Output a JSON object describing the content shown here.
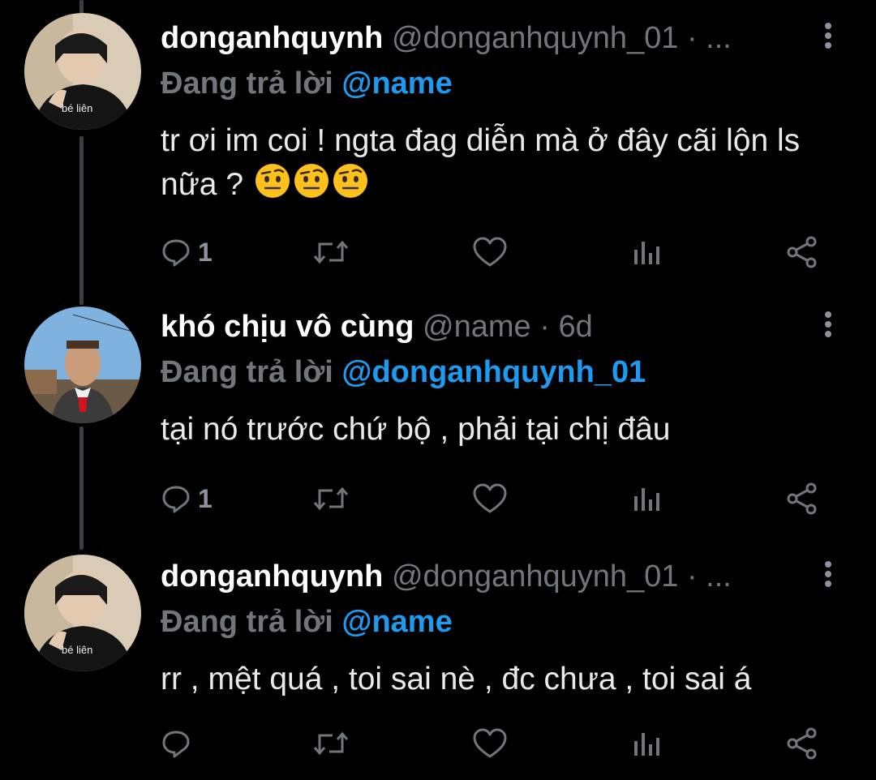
{
  "tweets": [
    {
      "display_name": "donganhquynh",
      "handle": "@donganhquynh_01",
      "meta": "· ...",
      "reply_prefix": "Đang trả lời ",
      "reply_to": "@name",
      "body": "tr ơi im coi ! ngta đag diễn mà ở đây cãi lộn ls nữa ?",
      "body_emojis": [
        "raised-eyebrow-emoji",
        "raised-eyebrow-emoji",
        "raised-eyebrow-emoji"
      ],
      "reply_count": "1",
      "avatar_text": "bé liên"
    },
    {
      "display_name": "khó chịu vô cùng",
      "handle": "@name",
      "meta": "· 6d",
      "reply_prefix": "Đang trả lời ",
      "reply_to": "@donganhquynh_01",
      "body": "tại nó trước chứ bộ , phải tại chị đâu",
      "reply_count": "1"
    },
    {
      "display_name": "donganhquynh",
      "handle": "@donganhquynh_01",
      "meta": "· ...",
      "reply_prefix": "Đang trả lời ",
      "reply_to": "@name",
      "body": "rr , mệt quá , toi sai nè , đc chưa , toi sai á",
      "reply_count": "",
      "avatar_text": "bé liên"
    }
  ],
  "icons": [
    "reply-icon",
    "retweet-icon",
    "like-icon",
    "analytics-icon",
    "share-icon",
    "more-icon"
  ],
  "colors": {
    "background": "#000000",
    "text": "#e7e9ea",
    "muted": "#71767b",
    "accent": "#1d9bf0"
  }
}
